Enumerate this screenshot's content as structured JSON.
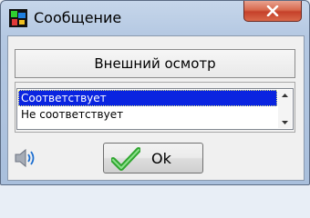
{
  "window": {
    "title": "Сообщение",
    "close_icon": "close-icon"
  },
  "header": {
    "text": "Внешний осмотр"
  },
  "list": {
    "items": [
      {
        "label": "Соответствует",
        "selected": true
      },
      {
        "label": "Не соответствует",
        "selected": false
      }
    ]
  },
  "buttons": {
    "ok_label": "Ok"
  },
  "colors": {
    "selection": "#0a24e0",
    "close": "#c5402a",
    "check": "#2fa52f"
  }
}
